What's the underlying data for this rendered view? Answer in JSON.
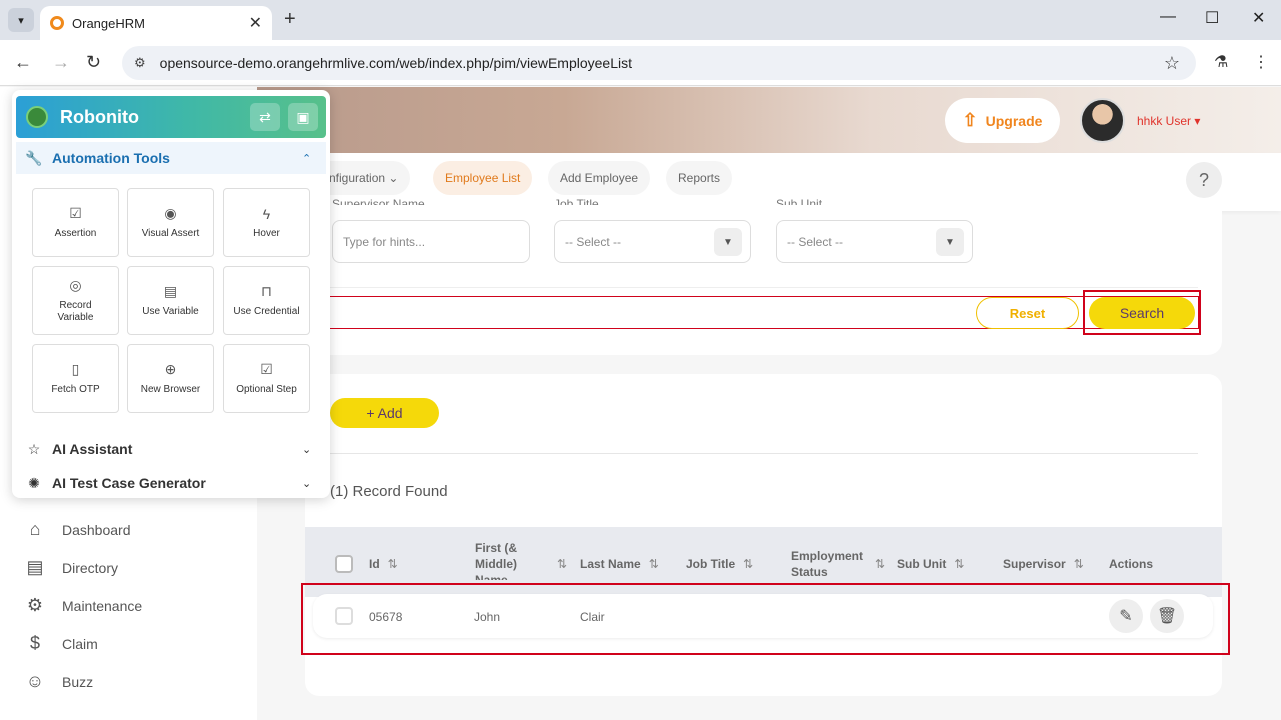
{
  "browser": {
    "tab_title": "OrangeHRM",
    "url": "opensource-demo.orangehrmlive.com/web/index.php/pim/viewEmployeeList"
  },
  "header": {
    "upgrade_label": "Upgrade",
    "username": "hhkk User"
  },
  "subnav": {
    "items": [
      "nfiguration",
      "Employee List",
      "Add Employee",
      "Reports"
    ],
    "help": "?"
  },
  "filters": {
    "supervisor_label": "Supervisor Name",
    "supervisor_placeholder": "Type for hints...",
    "job_title_label": "Job Title",
    "job_title_value": "-- Select --",
    "sub_unit_label": "Sub Unit",
    "sub_unit_value": "-- Select --",
    "reset_label": "Reset",
    "search_label": "Search"
  },
  "list": {
    "add_label": "+ Add",
    "records_text": "(1) Record Found",
    "columns": [
      "Id",
      "First (& Middle) Name",
      "Last Name",
      "Job Title",
      "Employment Status",
      "Sub Unit",
      "Supervisor",
      "Actions"
    ],
    "rows": [
      {
        "id": "05678",
        "first_name": "John",
        "last_name": "Clair",
        "job_title": "",
        "employment_status": "",
        "sub_unit": "",
        "supervisor": ""
      }
    ]
  },
  "sidebar": {
    "items": [
      "Dashboard",
      "Directory",
      "Maintenance",
      "Claim",
      "Buzz"
    ]
  },
  "robonito": {
    "title": "Robonito",
    "automation_tools": "Automation Tools",
    "tools": [
      "Assertion",
      "Visual Assert",
      "Hover",
      "Record Variable",
      "Use Variable",
      "Use Credential",
      "Fetch OTP",
      "New Browser",
      "Optional Step"
    ],
    "ai_assistant": "AI Assistant",
    "ai_test_case_generator": "AI Test Case Generator"
  },
  "colors": {
    "accent_orange": "#f0851e",
    "search_yellow": "#f5d90a",
    "highlight_red": "#d0021b"
  }
}
